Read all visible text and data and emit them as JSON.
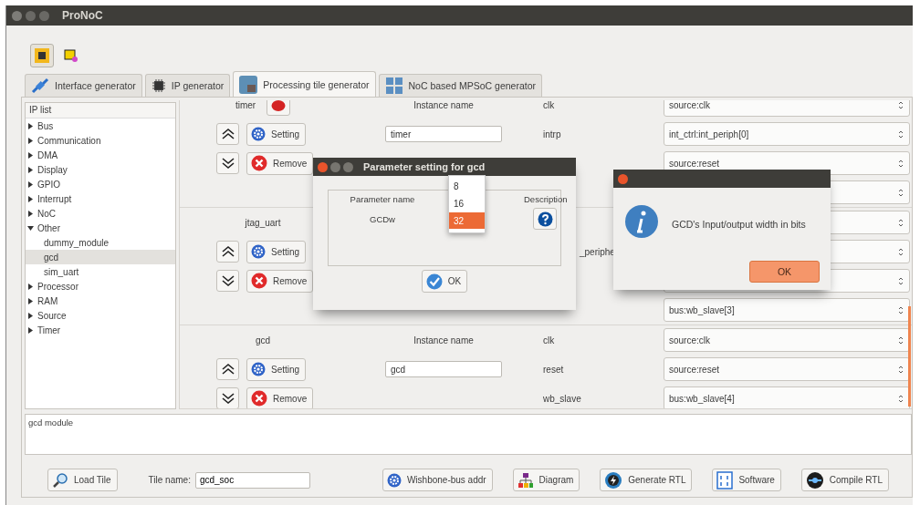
{
  "window": {
    "title": "ProNoC"
  },
  "toolbar": [
    {
      "kind": "chip",
      "selected": true
    },
    {
      "kind": "select",
      "selected": false
    }
  ],
  "tabs": [
    {
      "kind": "plug",
      "label": "Interface generator",
      "selected": false
    },
    {
      "kind": "chip",
      "label": "IP generator",
      "selected": false
    },
    {
      "kind": "tile",
      "label": "Processing tile generator",
      "selected": true
    },
    {
      "kind": "grid",
      "label": "NoC based MPSoC generator",
      "selected": false
    }
  ],
  "ip_list": {
    "header": "IP list",
    "items": [
      {
        "label": "Bus",
        "expanded": false,
        "selected": false
      },
      {
        "label": "Communication",
        "expanded": false,
        "selected": false
      },
      {
        "label": "DMA",
        "expanded": false,
        "selected": false
      },
      {
        "label": "Display",
        "expanded": false,
        "selected": false
      },
      {
        "label": "GPIO",
        "expanded": false,
        "selected": false
      },
      {
        "label": "Interrupt",
        "expanded": false,
        "selected": false
      },
      {
        "label": "NoC",
        "expanded": false,
        "selected": false
      },
      {
        "label": "Other",
        "expanded": true,
        "selected": false,
        "children": [
          {
            "label": "dummy_module",
            "selected": false
          },
          {
            "label": "gcd",
            "selected": true
          },
          {
            "label": "sim_uart",
            "selected": false
          }
        ]
      },
      {
        "label": "Processor",
        "expanded": false,
        "selected": false
      },
      {
        "label": "RAM",
        "expanded": false,
        "selected": false
      },
      {
        "label": "Source",
        "expanded": false,
        "selected": false
      },
      {
        "label": "Timer",
        "expanded": false,
        "selected": false
      }
    ]
  },
  "modules": [
    {
      "title": "timer",
      "delete_button": true,
      "instance_header": "Instance name",
      "instance_value": "timer",
      "setting": "Setting",
      "remove": "Remove",
      "ports": [
        {
          "kind": "combo",
          "label": "clk",
          "value": "source:clk"
        },
        {
          "kind": "combo",
          "label": "intrp",
          "value": "int_ctrl:int_periph[0]"
        },
        {
          "kind": "combo",
          "value": "source:reset"
        },
        {
          "kind": "combo"
        }
      ]
    },
    {
      "title": "jtag_uart",
      "delete_button": false,
      "setting": "Setting",
      "remove": "Remove",
      "ports": [
        {
          "kind": "combo"
        },
        {
          "kind": "clipped",
          "label": "_periphe"
        },
        {
          "kind": "combo"
        },
        {
          "kind": "combo",
          "value": "bus:wb_slave[3]"
        }
      ]
    },
    {
      "title": "gcd",
      "delete_button": false,
      "instance_header": "Instance name",
      "instance_value": "gcd",
      "setting": "Setting",
      "remove": "Remove",
      "ports": [
        {
          "kind": "combo",
          "label": "clk",
          "value": "source:clk"
        },
        {
          "kind": "combo",
          "label": "reset",
          "value": "source:reset"
        },
        {
          "kind": "combo",
          "label": "wb_slave",
          "value": "bus:wb_slave[4]"
        }
      ]
    }
  ],
  "description": "gcd module",
  "bottom_bar": {
    "load_button": "Load Tile",
    "tile_name": {
      "label": "Tile name:",
      "value": "gcd_soc"
    },
    "buttons": [
      {
        "kind": "bus",
        "label": "Wishbone-bus addr"
      },
      {
        "kind": "diagram",
        "label": "Diagram"
      },
      {
        "kind": "generate",
        "label": "Generate RTL"
      },
      {
        "kind": "software",
        "label": "Software"
      },
      {
        "kind": "compile",
        "label": "Compile RTL"
      }
    ]
  },
  "param_dialog": {
    "title": "Parameter setting for gcd",
    "columns": [
      "Parameter name",
      "Description"
    ],
    "params": [
      {
        "name": "GCDw"
      }
    ],
    "ok": "OK",
    "dropdown": [
      {
        "label": "8",
        "selected": false
      },
      {
        "label": "16",
        "selected": false
      },
      {
        "label": "32",
        "selected": true
      }
    ]
  },
  "info_dialog": {
    "message": "GCD's Input/output width in bits",
    "ok": "OK"
  }
}
